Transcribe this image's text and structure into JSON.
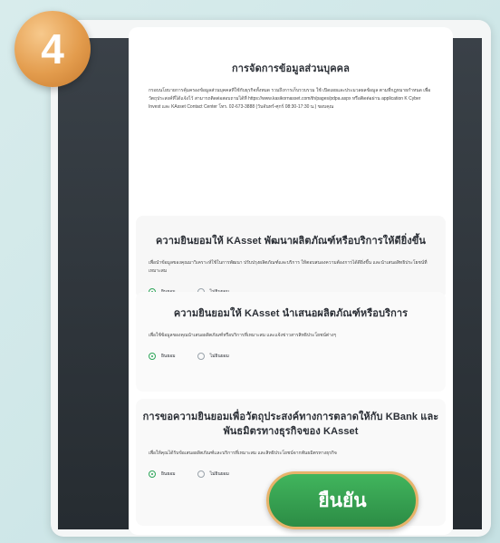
{
  "step_badge": "4",
  "sections": {
    "privacy": {
      "title": "การจัดการข้อมูลส่วนบุคคล",
      "body": "กรอบนโยบายการคุ้มครองข้อมูลส่วนบุคคลที่ใช้กับธุรกิจทั้งหมด รวมถึงการเก็บรวบรวม ใช้ เปิดเผยและประมวลผลข้อมูล ตามที่กฎหมายกำหนด เพื่อวัตถุประสงค์ที่ได้แจ้งไว้ สามารถติดต่อสอบถามได้ที่ https://www.kasikornasset.com/th/pages/pdpa.aspx หรือติดต่อผ่าน application K Cyber Invest และ KAsset Contact Center โทร. 02-673-3888 (วันจันทร์-ศุกร์ 08:30-17:30 น.) ขอบคุณ"
    },
    "consent1": {
      "title": "ความยินยอมให้ KAsset พัฒนาผลิตภัณฑ์หรือบริการให้ดียิ่งขึ้น",
      "body": "เพื่อนำข้อมูลของคุณมาวิเคราะห์ใช้ในการพัฒนา ปรับปรุงผลิตภัณฑ์และบริการ ให้ตอบสนองความต้องการได้ดียิ่งขึ้น และนำเสนอสิทธิประโยชน์ที่เหมาะสม",
      "yes": "ยินยอม",
      "no": "ไม่ยินยอม"
    },
    "consent2": {
      "title": "ความยินยอมให้ KAsset นำเสนอผลิตภัณฑ์หรือบริการ",
      "body": "เพื่อใช้ข้อมูลของคุณนำเสนอผลิตภัณฑ์หรือบริการที่เหมาะสม และแจ้งข่าวสารสิทธิประโยชน์ต่างๆ",
      "yes": "ยินยอม",
      "no": "ไม่ยินยอม"
    },
    "consent3": {
      "title": "การขอความยินยอมเพื่อวัตถุประสงค์ทางการตลาดให้กับ KBank และพันธมิตรทางธุรกิจของ KAsset",
      "body": "เพื่อให้คุณได้รับข้อเสนอผลิตภัณฑ์และบริการที่เหมาะสม และสิทธิประโยชน์จากพันธมิตรทางธุรกิจ",
      "yes": "ยินยอม",
      "no": "ไม่ยินยอม"
    }
  },
  "confirm_label": "ยืนยัน"
}
